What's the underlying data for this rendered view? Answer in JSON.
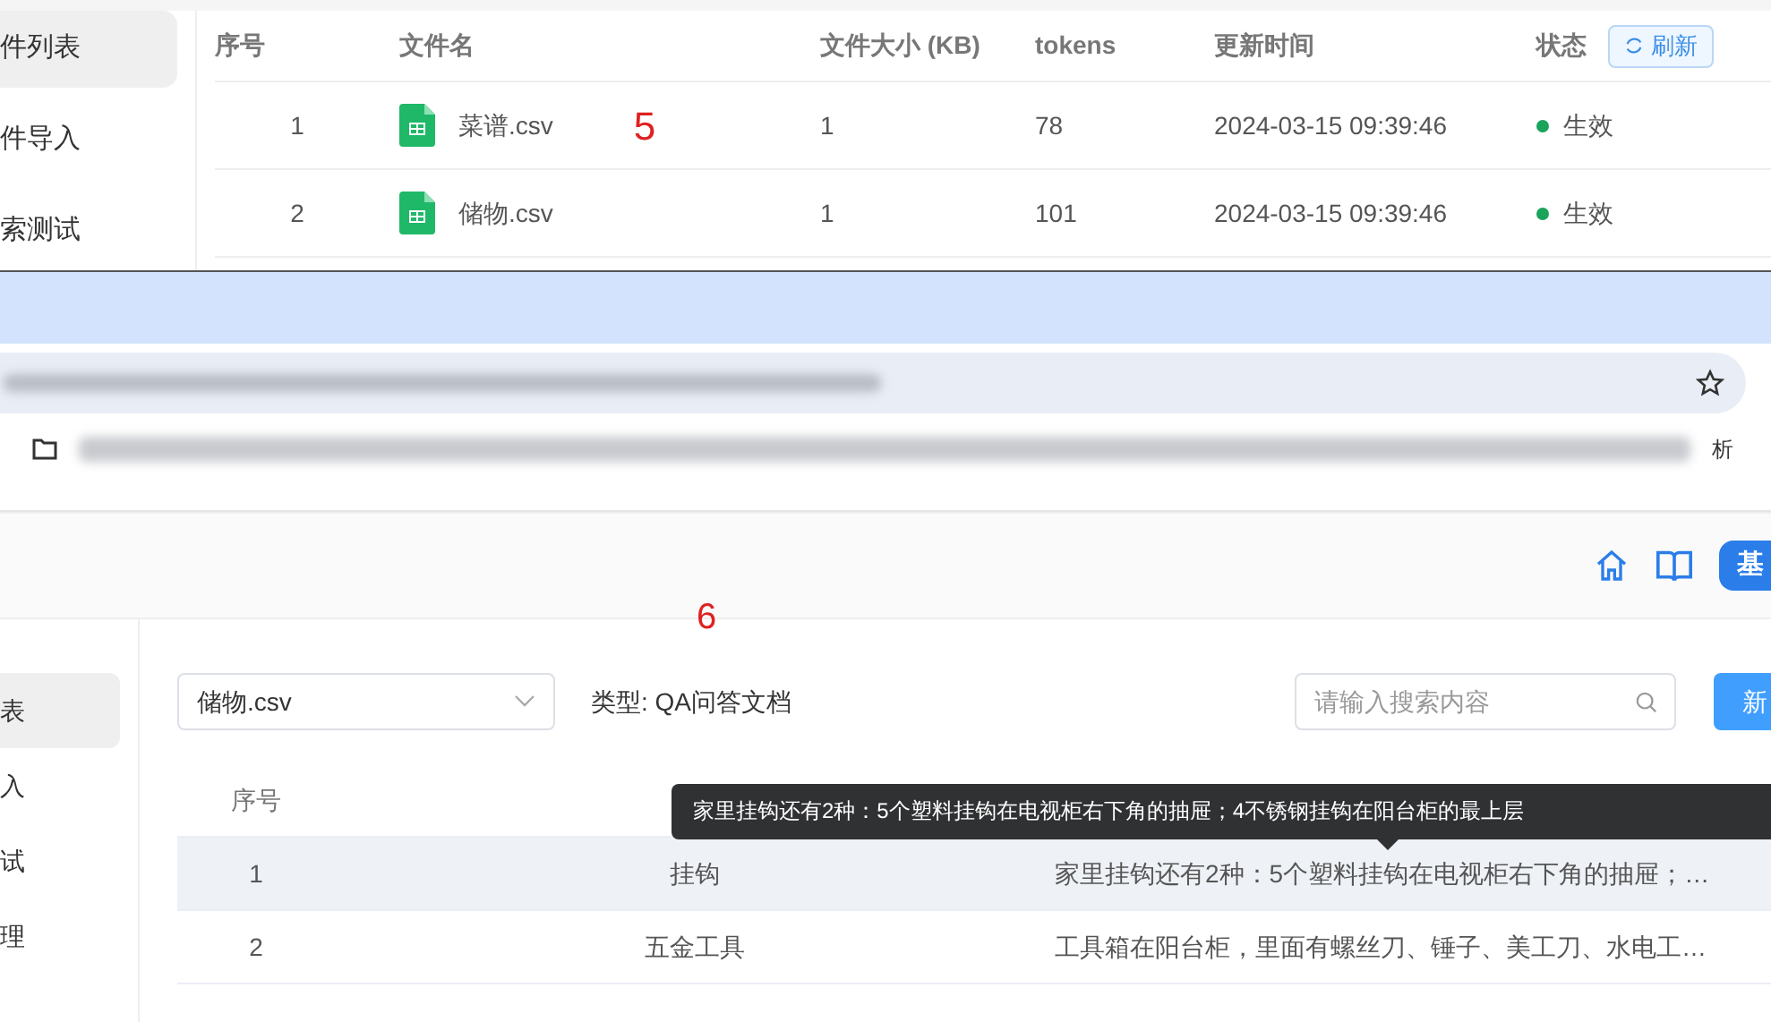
{
  "top_panel": {
    "annotation": "5",
    "sidebar": [
      {
        "label": "件列表",
        "selected": true
      },
      {
        "label": "件导入",
        "selected": false
      },
      {
        "label": "索测试",
        "selected": false
      }
    ],
    "table": {
      "columns": [
        "序号",
        "文件名",
        "文件大小 (KB)",
        "tokens",
        "更新时间",
        "状态"
      ],
      "refresh_button": "刷新",
      "rows": [
        {
          "index": "1",
          "name": "菜谱.csv",
          "size": "1",
          "tokens": "78",
          "updated": "2024-03-15 09:39:46",
          "status": "生效"
        },
        {
          "index": "2",
          "name": "储物.csv",
          "size": "1",
          "tokens": "101",
          "updated": "2024-03-15 09:39:46",
          "status": "生效"
        }
      ]
    }
  },
  "browser": {
    "bookmark_tail": "析"
  },
  "app": {
    "annotation": "6",
    "header_button": "基",
    "sidebar": [
      {
        "label": "表",
        "selected": true
      },
      {
        "label": "入",
        "selected": false
      },
      {
        "label": "试",
        "selected": false
      },
      {
        "label": "理",
        "selected": false
      }
    ],
    "file_select": "储物.csv",
    "type_label": "类型: QA问答文档",
    "search": {
      "placeholder": "请输入搜索内容"
    },
    "new_button": "新",
    "table": {
      "columns": [
        "序号"
      ],
      "rows": [
        {
          "index": "1",
          "question": "挂钩",
          "answer": "家里挂钩还有2种：5个塑料挂钩在电视柜右下角的抽屉；…",
          "hovered": true
        },
        {
          "index": "2",
          "question": "五金工具",
          "answer": "工具箱在阳台柜，里面有螺丝刀、锤子、美工刀、水电工…",
          "hovered": false
        }
      ]
    },
    "tooltip": "家里挂钩还有2种：5个塑料挂钩在电视柜右下角的抽屉；4不锈钢挂钩在阳台柜的最上层"
  }
}
